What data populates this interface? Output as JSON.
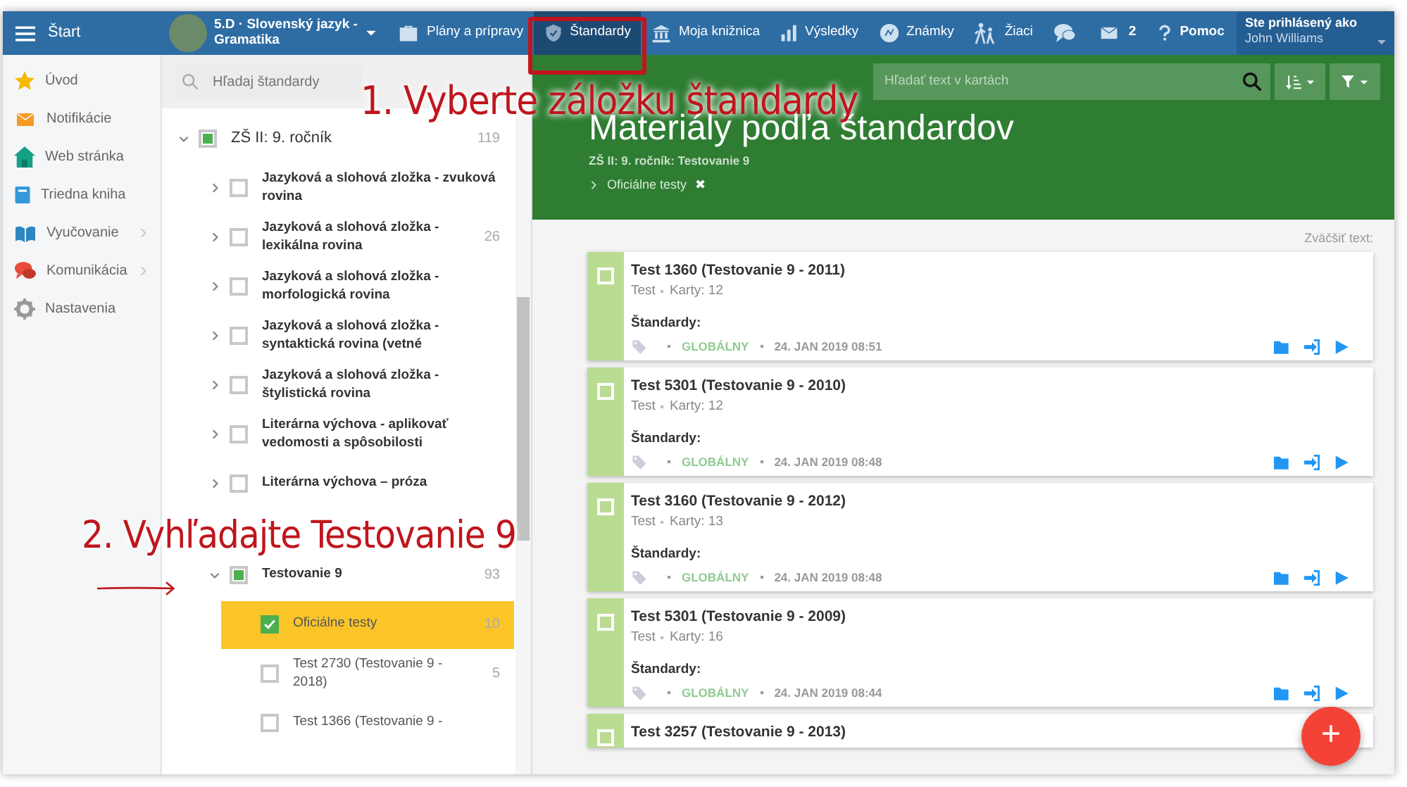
{
  "topbar": {
    "menu_label": "Štart",
    "class_selector": {
      "title": "5.D · Slovenský jazyk - Gramatika"
    },
    "nav": [
      {
        "kind": "plans",
        "label": "Plány a prípravy",
        "selected": false
      },
      {
        "kind": "standards",
        "label": "Štandardy",
        "selected": true
      },
      {
        "kind": "library",
        "label": "Moja knižnica",
        "selected": false
      },
      {
        "kind": "results",
        "label": "Výsledky",
        "selected": false
      },
      {
        "kind": "grades",
        "label": "Známky",
        "selected": false
      },
      {
        "kind": "pupils",
        "label": "Žiaci",
        "selected": false
      },
      {
        "kind": "chat",
        "selected": false
      },
      {
        "kind": "messages",
        "label": "2",
        "selected": false
      },
      {
        "kind": "help",
        "label": "Pomoc",
        "selected": false
      }
    ],
    "user": {
      "caption": "Ste prihlásený ako",
      "name": "John Williams"
    }
  },
  "sidebar": {
    "items": [
      {
        "kind": "home",
        "label": "Úvod",
        "submenu": false
      },
      {
        "kind": "notifications",
        "label": "Notifikácie",
        "submenu": false
      },
      {
        "kind": "website",
        "label": "Web stránka",
        "submenu": false
      },
      {
        "kind": "classbook",
        "label": "Triedna kniha",
        "submenu": false
      },
      {
        "kind": "teaching",
        "label": "Vyučovanie",
        "submenu": true
      },
      {
        "kind": "communication",
        "label": "Komunikácia",
        "submenu": true
      },
      {
        "kind": "settings",
        "label": "Nastavenia",
        "submenu": false
      }
    ]
  },
  "tree": {
    "search": {
      "placeholder": "Hľadaj štandardy"
    },
    "items": [
      {
        "label": "ZŠ II: 9. ročník",
        "count": "119",
        "checked": false,
        "partial": true,
        "selected": false,
        "expanded": true,
        "children": [
          {
            "label": "Jazyková a slohová zložka - zvuková rovina",
            "checked": false,
            "partial": false,
            "selected": false,
            "expanded": false
          },
          {
            "label": "Jazyková a slohová zložka - lexikálna rovina",
            "count": "26",
            "checked": false,
            "partial": false,
            "selected": false,
            "expanded": false
          },
          {
            "label": "Jazyková a slohová zložka - morfologická rovina",
            "checked": false,
            "partial": false,
            "selected": false,
            "expanded": false
          },
          {
            "label": "Jazyková a slohová zložka - syntaktická rovina (vetné",
            "checked": false,
            "partial": false,
            "selected": false,
            "expanded": false
          },
          {
            "label": "Jazyková a slohová zložka - štylistická rovina",
            "checked": false,
            "partial": false,
            "selected": false,
            "expanded": false
          },
          {
            "label": "Literárna výchova - aplikovať vedomosti a spôsobilosti",
            "checked": false,
            "partial": false,
            "selected": false,
            "expanded": false
          },
          {
            "label": "Literárna výchova – próza",
            "checked": false,
            "partial": false,
            "selected": false,
            "expanded": false
          },
          {
            "label": "Testovanie 9",
            "count": "93",
            "checked": false,
            "partial": true,
            "selected": false,
            "expanded": true,
            "children": [
              {
                "label": "Oficiálne testy",
                "count": "10",
                "checked": true,
                "partial": false,
                "selected": true
              },
              {
                "label": "Test 2730 (Testovanie 9 - 2018)",
                "count": "5",
                "checked": false,
                "partial": false,
                "selected": false
              },
              {
                "label": "Test 1366 (Testovanie 9 -",
                "checked": false,
                "partial": false,
                "selected": false
              }
            ]
          }
        ]
      }
    ]
  },
  "main": {
    "search": {
      "placeholder": "Hľadať text v kartách"
    },
    "title": "Materiály podľa štandardov",
    "subtitle": "ZŠ II: 9. ročník: Testovanie 9",
    "filter_chip": {
      "label": "Oficiálne testy",
      "remove": "✖"
    },
    "zoom_label": "Zväčšiť text:",
    "cards": [
      {
        "title": "Test 1360 (Testovanie 9 - 2011)",
        "checked": false,
        "type": "Test",
        "count": "Karty: 12",
        "standards_label": "Štandardy:",
        "scope": "GLOBÁLNY",
        "date": "24. JAN 2019 08:51"
      },
      {
        "title": "Test 5301 (Testovanie 9 - 2010)",
        "checked": false,
        "type": "Test",
        "count": "Karty: 12",
        "standards_label": "Štandardy:",
        "scope": "GLOBÁLNY",
        "date": "24. JAN 2019 08:48"
      },
      {
        "title": "Test 3160 (Testovanie 9 - 2012)",
        "checked": false,
        "type": "Test",
        "count": "Karty: 13",
        "standards_label": "Štandardy:",
        "scope": "GLOBÁLNY",
        "date": "24. JAN 2019 08:48"
      },
      {
        "title": "Test 5301 (Testovanie 9 - 2009)",
        "checked": false,
        "type": "Test",
        "count": "Karty: 16",
        "standards_label": "Štandardy:",
        "scope": "GLOBÁLNY",
        "date": "24. JAN 2019 08:44"
      },
      {
        "title": "Test 3257 (Testovanie 9 - 2013)",
        "checked": false
      }
    ],
    "fab_label": "+"
  },
  "annotations": [
    {
      "kind": "highlight"
    },
    {
      "kind": "text",
      "text": "1. Vyberte záložku štandardy"
    },
    {
      "kind": "text",
      "text": "2. Vyhľadajte Testovanie 9"
    },
    {
      "kind": "arrow"
    }
  ]
}
